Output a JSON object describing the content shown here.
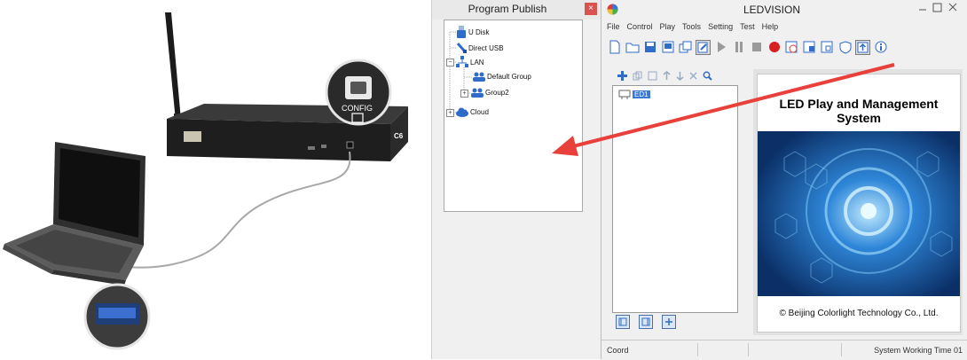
{
  "program_publish": {
    "title": "Program Publish",
    "close_glyph": "×",
    "tree": [
      {
        "label": "U Disk",
        "icon": "usb-drive-icon"
      },
      {
        "label": "Direct USB",
        "icon": "usb-cable-icon"
      },
      {
        "label": "LAN",
        "icon": "network-icon"
      },
      {
        "label": "Default Group",
        "icon": "group-icon"
      },
      {
        "label": "Group2",
        "icon": "group-icon"
      },
      {
        "label": "Cloud",
        "icon": "cloud-icon"
      }
    ]
  },
  "ledvision": {
    "title": "LEDVISION",
    "menu": [
      "File",
      "Control",
      "Play",
      "Tools",
      "Setting",
      "Test",
      "Help"
    ],
    "toolbar_icons": [
      "new-file-icon",
      "open-folder-icon",
      "save-icon",
      "screen-icon",
      "layers-icon",
      "edit-icon",
      "play-icon",
      "pause-icon",
      "stop-icon",
      "record-icon",
      "timer-icon",
      "screen-param-icon",
      "screen-window-icon",
      "shield-icon",
      "cloud-publish-icon",
      "info-icon"
    ],
    "subtoolbar_icons": [
      "add-icon",
      "copy-icon",
      "paste-icon",
      "move-up-icon",
      "move-down-icon",
      "delete-icon",
      "search-icon"
    ],
    "tree_node_label": "ED1",
    "splash": {
      "title": "LED Play and Management System",
      "copyright": "© Beijing Colorlight Technology Co., Ltd."
    },
    "status": {
      "coord": "Coord",
      "time": "System Working Time 01"
    }
  },
  "illustration": {
    "config_label": "CONFIG",
    "model_label": "C6"
  },
  "colors": {
    "accent_red": "#e8403a",
    "splash_blue": "#1c5a9c",
    "close_red": "#d9534f"
  }
}
